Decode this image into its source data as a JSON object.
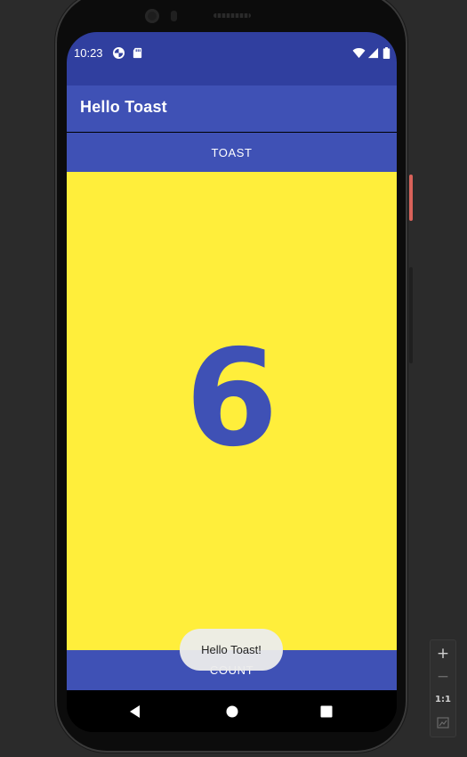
{
  "status_bar": {
    "time": "10:23",
    "left_icons": [
      "data-saver-icon",
      "sd-card-icon"
    ],
    "right_icons": [
      "wifi-icon",
      "signal-icon",
      "battery-icon"
    ],
    "background": "#303f9f"
  },
  "app_bar": {
    "title": "Hello Toast",
    "background": "#3f51b5"
  },
  "toast_button": {
    "label": "TOAST"
  },
  "count_display": {
    "value": "6",
    "background": "#ffee3b",
    "text_color": "#3f51b5"
  },
  "count_button": {
    "label": "COUNT"
  },
  "toast_popup": {
    "message": "Hello Toast!"
  },
  "nav_bar": {
    "buttons": [
      "back-icon",
      "home-icon",
      "recents-icon"
    ]
  },
  "zoom_toolbar": {
    "zoom_in": "+",
    "zoom_out": "−",
    "actual_size": "1:1",
    "fit_icon": "fit-screen-icon"
  }
}
